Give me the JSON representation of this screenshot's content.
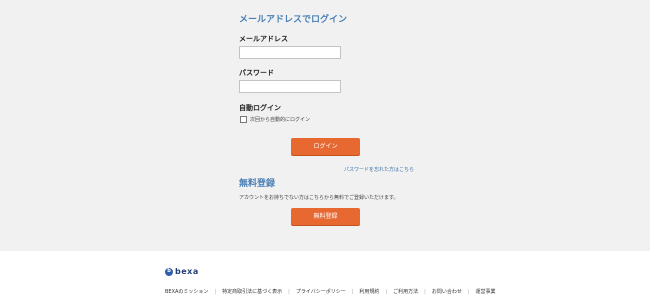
{
  "login": {
    "title": "メールアドレスでログイン",
    "email_label": "メールアドレス",
    "email_value": "",
    "password_label": "パスワード",
    "password_value": "",
    "auto_login_label": "自動ログイン",
    "auto_login_checkbox_label": "次回から自動的にログイン",
    "auto_login_checked": false,
    "login_button": "ログイン",
    "forgot_password_link": "パスワードを忘れた方はこちら"
  },
  "register": {
    "title": "無料登録",
    "description": "アカウントをお持ちでない方はこちらから無料でご登録いただけます。",
    "button": "無料登録"
  },
  "footer": {
    "logo_text": "bexa",
    "links": [
      "BEXAのミッション",
      "特定商取引法に基づく表示",
      "プライバシーポリシー",
      "利用規約",
      "ご利用方法",
      "お問い合わせ",
      "運営事業"
    ]
  },
  "colors": {
    "accent": "#e86832",
    "heading": "#4a7fb5",
    "link": "#3b6fa8",
    "background": "#f1f1f1",
    "brand": "#2f5fa8"
  }
}
